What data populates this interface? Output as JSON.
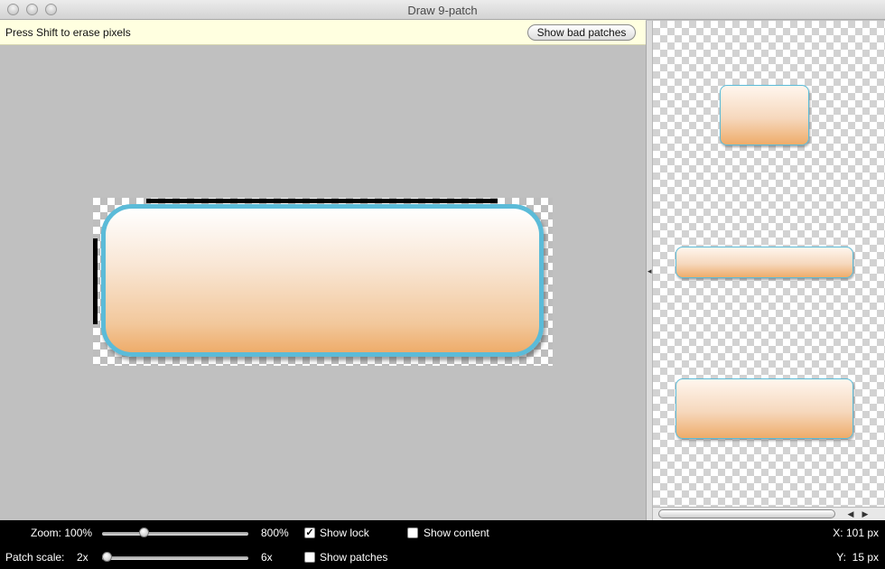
{
  "window": {
    "title": "Draw 9-patch"
  },
  "hint": {
    "text": "Press Shift to erase pixels"
  },
  "buttons": {
    "show_bad_patches": "Show bad patches"
  },
  "zoom": {
    "label": "Zoom: 100%",
    "max_label": "800%",
    "value_fraction": 0.27
  },
  "patch_scale": {
    "label": "Patch scale:",
    "min_label": "2x",
    "max_label": "6x",
    "value_fraction": 0.0
  },
  "options": {
    "show_lock": {
      "label": "Show lock",
      "checked": true,
      "mark": "✓"
    },
    "show_patches": {
      "label": "Show patches",
      "checked": false
    },
    "show_content": {
      "label": "Show content",
      "checked": false
    }
  },
  "coords": {
    "x": "X: 101 px",
    "y": "Y:  15 px"
  },
  "colors": {
    "button_border": "#5bbbd8",
    "gradient_top": "#ffffff",
    "gradient_bottom": "#eeac6a",
    "hint_bg": "#ffffe0"
  },
  "icons": {
    "scroll_left": "◀",
    "scroll_right": "▶",
    "divider_grip": "◂"
  }
}
